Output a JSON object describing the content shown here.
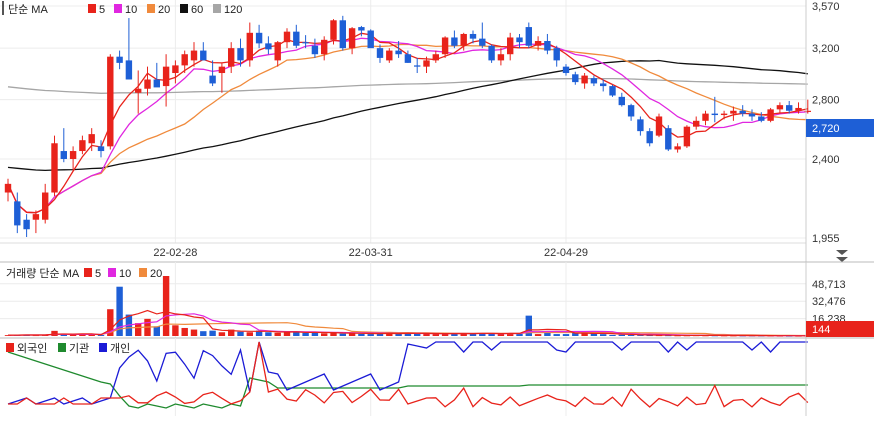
{
  "colors": {
    "up": "#e8231b",
    "down": "#1e5fd6",
    "ma5": "#e8231b",
    "ma10": "#e027e0",
    "ma20": "#f08a3c",
    "ma60": "#111111",
    "ma120": "#a6a6a6",
    "foreign": "#e8231b",
    "institution": "#1f8a2e",
    "individual": "#1b1bd6",
    "price_tag": "#1e5fd6",
    "volume_tag": "#e8231b"
  },
  "price_legend": {
    "title": "단순 MA",
    "items": [
      {
        "label": "5",
        "color": "#e8231b"
      },
      {
        "label": "10",
        "color": "#e027e0"
      },
      {
        "label": "20",
        "color": "#f08a3c"
      },
      {
        "label": "60",
        "color": "#111111"
      },
      {
        "label": "120",
        "color": "#a6a6a6"
      }
    ]
  },
  "volume_legend": {
    "title": "거래량 단순 MA",
    "items": [
      {
        "label": "5",
        "color": "#e8231b"
      },
      {
        "label": "10",
        "color": "#e027e0"
      },
      {
        "label": "20",
        "color": "#f08a3c"
      }
    ]
  },
  "investor_legend": {
    "items": [
      {
        "label": "외국인",
        "color": "#e8231b"
      },
      {
        "label": "기관",
        "color": "#1f8a2e"
      },
      {
        "label": "개인",
        "color": "#1b1bd6"
      }
    ]
  },
  "chart_data": [
    {
      "type": "candlestick",
      "ylim": [
        1955,
        3570
      ],
      "y_ticks": [
        3570,
        3200,
        2800,
        2400,
        1955
      ],
      "x_ticks": [
        "22-02-28",
        "22-03-31",
        "22-04-29"
      ],
      "current_price": 2720,
      "candles": [
        [
          2200,
          2280,
          2150,
          2250
        ],
        [
          2150,
          2200,
          1980,
          2020
        ],
        [
          2050,
          2080,
          1960,
          2000
        ],
        [
          2050,
          2100,
          1980,
          2080
        ],
        [
          2050,
          2250,
          2030,
          2200
        ],
        [
          2200,
          2550,
          2180,
          2500
        ],
        [
          2450,
          2600,
          2380,
          2400
        ],
        [
          2400,
          2480,
          2330,
          2450
        ],
        [
          2450,
          2550,
          2430,
          2520
        ],
        [
          2500,
          2600,
          2450,
          2560
        ],
        [
          2480,
          2520,
          2410,
          2450
        ],
        [
          2480,
          3150,
          2460,
          3130
        ],
        [
          3130,
          3180,
          3030,
          3080
        ],
        [
          3100,
          3460,
          2950,
          2950
        ],
        [
          2850,
          3020,
          2700,
          2880
        ],
        [
          2880,
          3050,
          2830,
          2950
        ],
        [
          2950,
          3080,
          2900,
          2890
        ],
        [
          2900,
          3150,
          2750,
          3050
        ],
        [
          3000,
          3100,
          2920,
          3060
        ],
        [
          3060,
          3180,
          3000,
          3150
        ],
        [
          3100,
          3250,
          3050,
          3180
        ],
        [
          3180,
          3250,
          3100,
          3100
        ],
        [
          2980,
          3100,
          2900,
          2920
        ],
        [
          3000,
          3080,
          2850,
          3050
        ],
        [
          3050,
          3250,
          3000,
          3200
        ],
        [
          3200,
          3280,
          3050,
          3100
        ],
        [
          3100,
          3420,
          3050,
          3330
        ],
        [
          3330,
          3400,
          3200,
          3240
        ],
        [
          3240,
          3300,
          3150,
          3190
        ],
        [
          3100,
          3260,
          3050,
          3250
        ],
        [
          3250,
          3370,
          3200,
          3340
        ],
        [
          3340,
          3400,
          3200,
          3220
        ],
        [
          3250,
          3310,
          3200,
          3240
        ],
        [
          3220,
          3280,
          3120,
          3150
        ],
        [
          3150,
          3300,
          3100,
          3270
        ],
        [
          3270,
          3450,
          3230,
          3440
        ],
        [
          3440,
          3480,
          3180,
          3200
        ],
        [
          3200,
          3380,
          3150,
          3370
        ],
        [
          3380,
          3390,
          3300,
          3350
        ],
        [
          3350,
          3360,
          3250,
          3200
        ],
        [
          3200,
          3230,
          3080,
          3120
        ],
        [
          3100,
          3200,
          3080,
          3180
        ],
        [
          3180,
          3260,
          3120,
          3150
        ],
        [
          3150,
          3180,
          3080,
          3080
        ],
        [
          3060,
          3120,
          3000,
          3050
        ],
        [
          3050,
          3130,
          3000,
          3100
        ],
        [
          3100,
          3180,
          3080,
          3150
        ],
        [
          3150,
          3300,
          3120,
          3290
        ],
        [
          3290,
          3350,
          3200,
          3220
        ],
        [
          3220,
          3330,
          3180,
          3320
        ],
        [
          3320,
          3350,
          3240,
          3280
        ],
        [
          3280,
          3420,
          3200,
          3220
        ],
        [
          3220,
          3230,
          3080,
          3100
        ],
        [
          3100,
          3200,
          3060,
          3150
        ],
        [
          3150,
          3330,
          3100,
          3290
        ],
        [
          3290,
          3320,
          3200,
          3250
        ],
        [
          3380,
          3420,
          3200,
          3220
        ],
        [
          3220,
          3300,
          3180,
          3260
        ],
        [
          3260,
          3320,
          3150,
          3180
        ],
        [
          3200,
          3220,
          3050,
          3100
        ],
        [
          3050,
          3070,
          2980,
          3000
        ],
        [
          2990,
          3010,
          2910,
          2930
        ],
        [
          2920,
          3000,
          2880,
          2980
        ],
        [
          2960,
          2980,
          2900,
          2920
        ],
        [
          2920,
          2950,
          2860,
          2900
        ],
        [
          2900,
          2910,
          2820,
          2830
        ],
        [
          2820,
          2850,
          2750,
          2760
        ],
        [
          2760,
          2770,
          2650,
          2680
        ],
        [
          2660,
          2680,
          2550,
          2580
        ],
        [
          2580,
          2600,
          2480,
          2500
        ],
        [
          2550,
          2700,
          2540,
          2680
        ],
        [
          2600,
          2620,
          2450,
          2460
        ],
        [
          2460,
          2500,
          2440,
          2480
        ],
        [
          2480,
          2620,
          2470,
          2610
        ],
        [
          2610,
          2680,
          2590,
          2650
        ],
        [
          2650,
          2720,
          2620,
          2700
        ],
        [
          2700,
          2820,
          2640,
          2690
        ],
        [
          2690,
          2720,
          2660,
          2700
        ],
        [
          2700,
          2750,
          2650,
          2720
        ],
        [
          2720,
          2760,
          2680,
          2700
        ],
        [
          2700,
          2730,
          2650,
          2680
        ],
        [
          2680,
          2710,
          2640,
          2650
        ],
        [
          2650,
          2740,
          2640,
          2730
        ],
        [
          2730,
          2780,
          2700,
          2760
        ],
        [
          2760,
          2790,
          2700,
          2720
        ],
        [
          2720,
          2780,
          2700,
          2740
        ],
        [
          2720,
          2800,
          2700,
          2720
        ]
      ]
    },
    {
      "type": "bar",
      "series": [
        {
          "name": "거래량",
          "unit": "thousand"
        }
      ],
      "y_ticks": [
        48713,
        32476,
        16238
      ],
      "current_volume": 144,
      "values": [
        800,
        900,
        1200,
        700,
        1100,
        4800,
        1500,
        1000,
        1200,
        1600,
        900,
        25000,
        46000,
        20000,
        12000,
        16000,
        9000,
        56000,
        10000,
        7500,
        6000,
        4500,
        5000,
        3500,
        6000,
        4000,
        3500,
        5000,
        3500,
        3000,
        3500,
        4000,
        3000,
        3200,
        2500,
        3000,
        2200,
        2800,
        2000,
        1800,
        2500,
        3000,
        2000,
        2800,
        2300,
        2100,
        1800,
        2400,
        2600,
        2100,
        2500,
        2800,
        1900,
        2200,
        2600,
        2800,
        1800,
        1800,
        2700,
        1800,
        1800,
        3200,
        2400,
        2800,
        1700,
        1000,
        1200,
        900,
        800,
        700,
        650,
        600,
        500,
        500,
        600,
        500,
        500,
        450,
        400,
        350,
        350,
        300,
        250,
        200,
        180,
        150,
        150
      ],
      "big_bar_1": 19000,
      "big_bar_1_index": 56,
      "big_bar_2": 4500,
      "big_bar_2_index": 58
    },
    {
      "type": "line",
      "series": [
        {
          "name": "외국인",
          "values": [
            0,
            0,
            -0.6,
            -0.3,
            0,
            0.2,
            -0.2,
            0,
            -0.2,
            0,
            0,
            -0.2,
            0.2,
            -0.7,
            -0.1,
            -0.1,
            0,
            0.1,
            -0.1,
            -0.2,
            0,
            0.3,
            0,
            -0.1,
            -0.2,
            0,
            -0.3,
            -0.1,
            0.1,
            -0.2,
            -0.2,
            0,
            0,
            -0.3,
            -0.2,
            -0.1,
            1.5,
            -0.5,
            -0.8,
            -0.3,
            -0.2,
            0,
            0.5,
            -0.1,
            -0.3,
            -0.2,
            0,
            0,
            -0.5,
            -0.2,
            0,
            -0.3,
            -0.2,
            0,
            0,
            0,
            0.7,
            0,
            -0.3,
            -0.2,
            0,
            -0.2,
            -0.2,
            0,
            -0.2,
            -0.2,
            0,
            -0.3,
            -0.2,
            0,
            -0.1,
            0,
            -0.2,
            0,
            0,
            -0.1,
            -0.2,
            0,
            0,
            -0.1,
            -0.2,
            0,
            0,
            -0.1,
            -0.2,
            0,
            0
          ]
        },
        {
          "name": "기관",
          "values": []
        },
        {
          "name": "개인",
          "values": []
        }
      ]
    }
  ]
}
